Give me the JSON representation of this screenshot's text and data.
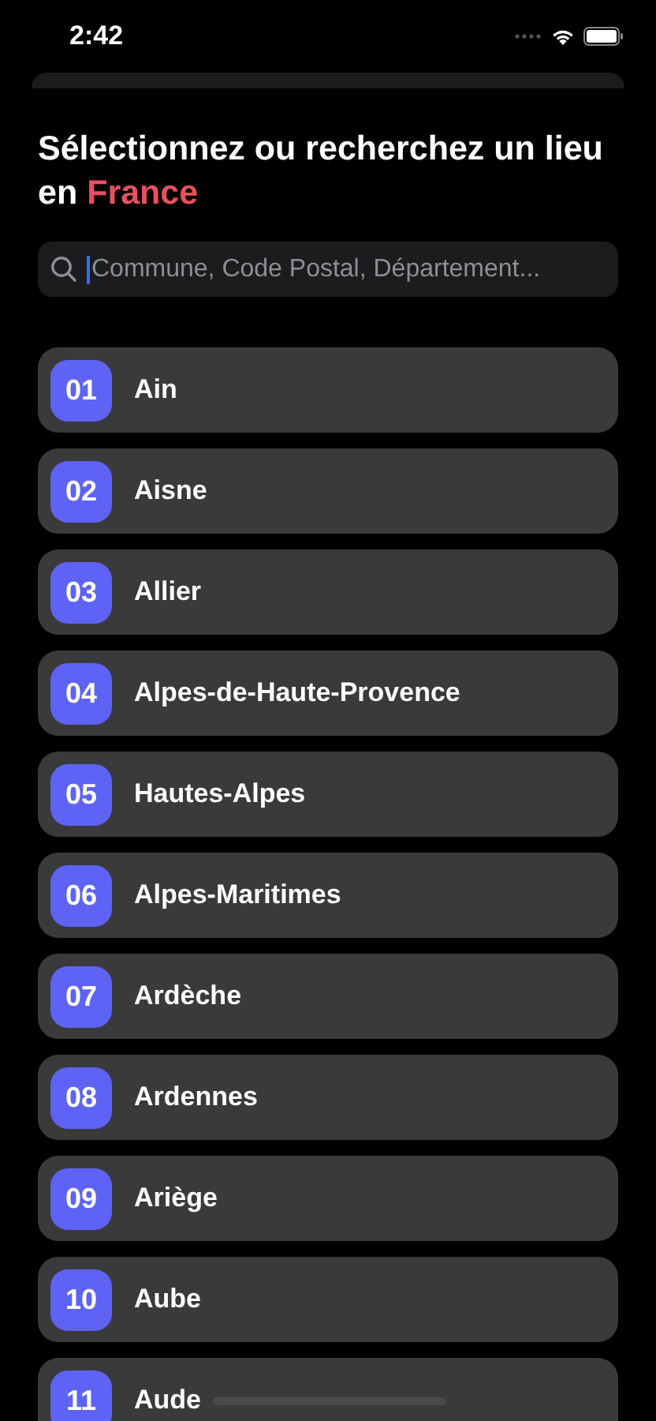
{
  "status_bar": {
    "time": "2:42"
  },
  "title": {
    "text": "Sélectionnez ou recherchez un lieu en",
    "highlight": "France"
  },
  "search": {
    "placeholder": "Commune, Code Postal, Département..."
  },
  "departments": [
    {
      "code": "01",
      "name": "Ain"
    },
    {
      "code": "02",
      "name": "Aisne"
    },
    {
      "code": "03",
      "name": "Allier"
    },
    {
      "code": "04",
      "name": "Alpes-de-Haute-Provence"
    },
    {
      "code": "05",
      "name": "Hautes-Alpes"
    },
    {
      "code": "06",
      "name": "Alpes-Maritimes"
    },
    {
      "code": "07",
      "name": "Ardèche"
    },
    {
      "code": "08",
      "name": "Ardennes"
    },
    {
      "code": "09",
      "name": "Ariège"
    },
    {
      "code": "10",
      "name": "Aube"
    },
    {
      "code": "11",
      "name": "Aude"
    }
  ]
}
